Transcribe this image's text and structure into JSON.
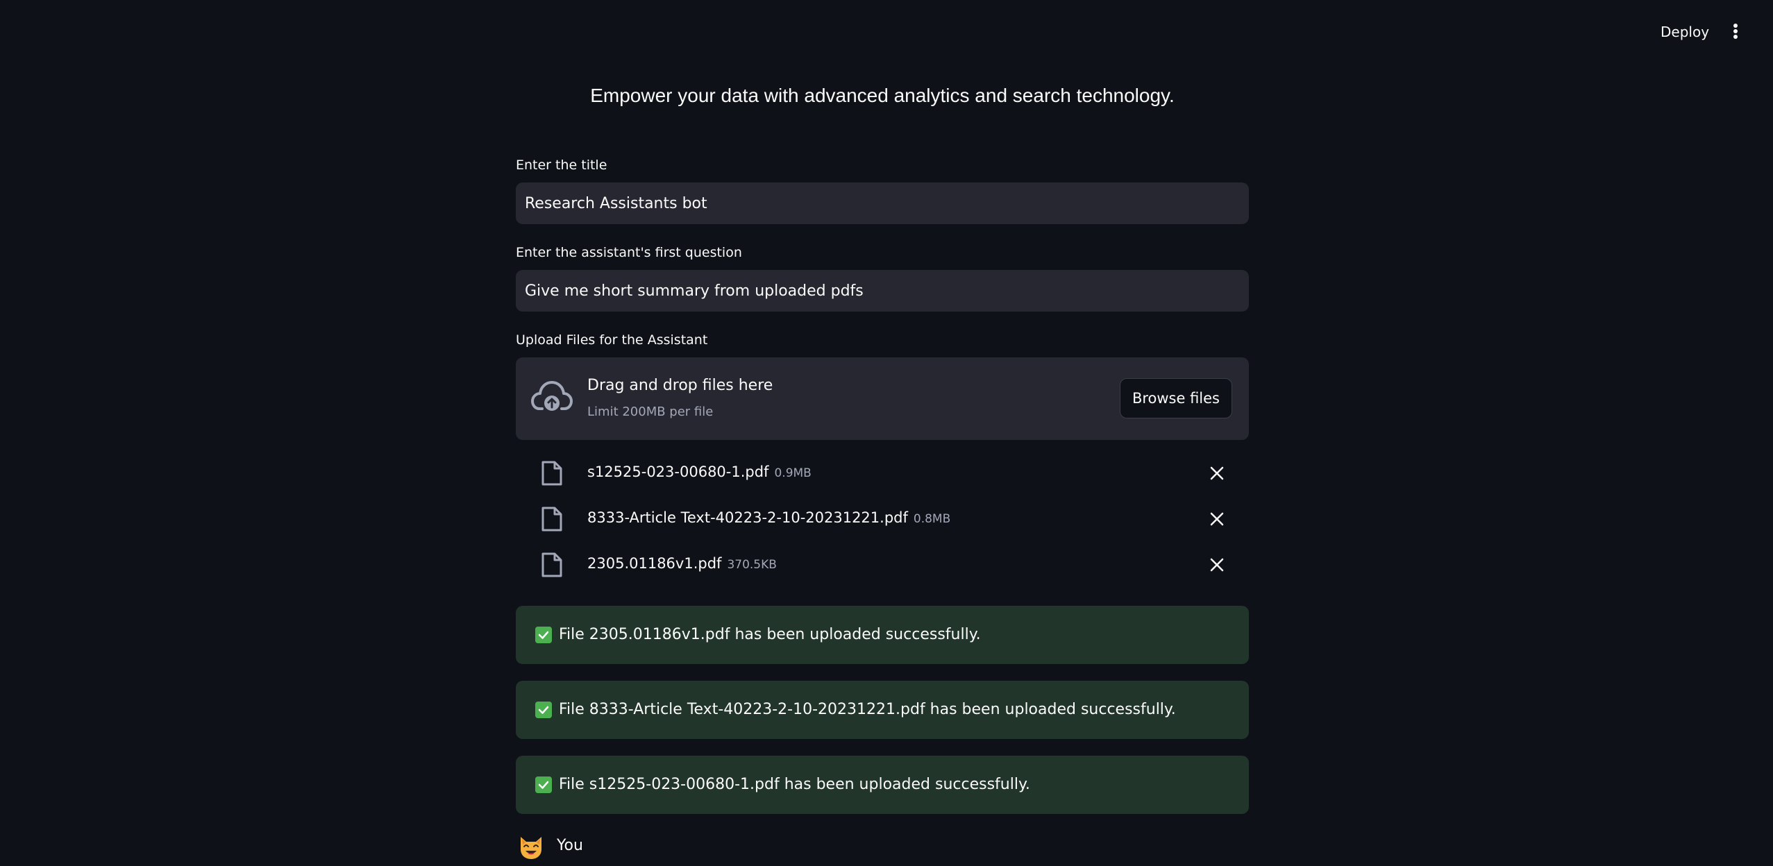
{
  "header": {
    "deploy_label": "Deploy",
    "menu_icon": "kebab-vertical-icon"
  },
  "main": {
    "tagline": "Empower your data with advanced analytics and search technology.",
    "title_field": {
      "label": "Enter the title",
      "value": "Research Assistants bot"
    },
    "question_field": {
      "label": "Enter the assistant's first question",
      "value": "Give me short summary from uploaded pdfs"
    },
    "uploader": {
      "label": "Upload Files for the Assistant",
      "drop_text": "Drag and drop files here",
      "limit_text": "Limit 200MB per file",
      "browse_label": "Browse files",
      "icon": "cloud-upload-icon",
      "files": [
        {
          "name": "s12525-023-00680-1.pdf",
          "size": "0.9MB"
        },
        {
          "name": "8333-Article Text-40223-2-10-20231221.pdf",
          "size": "0.8MB"
        },
        {
          "name": "2305.01186v1.pdf",
          "size": "370.5KB"
        }
      ]
    },
    "alerts": [
      "File 2305.01186v1.pdf has been uploaded successfully.",
      "File 8333-Article Text-40223-2-10-20231221.pdf has been uploaded successfully.",
      "File s12525-023-00680-1.pdf has been uploaded successfully."
    ],
    "chat": {
      "author": "You",
      "avatar": "smiling-cat-emoji"
    }
  },
  "colors": {
    "background": "#0e1117",
    "input_bg": "#262730",
    "success_bg": "#21352b",
    "success_check": "#4caf50"
  }
}
